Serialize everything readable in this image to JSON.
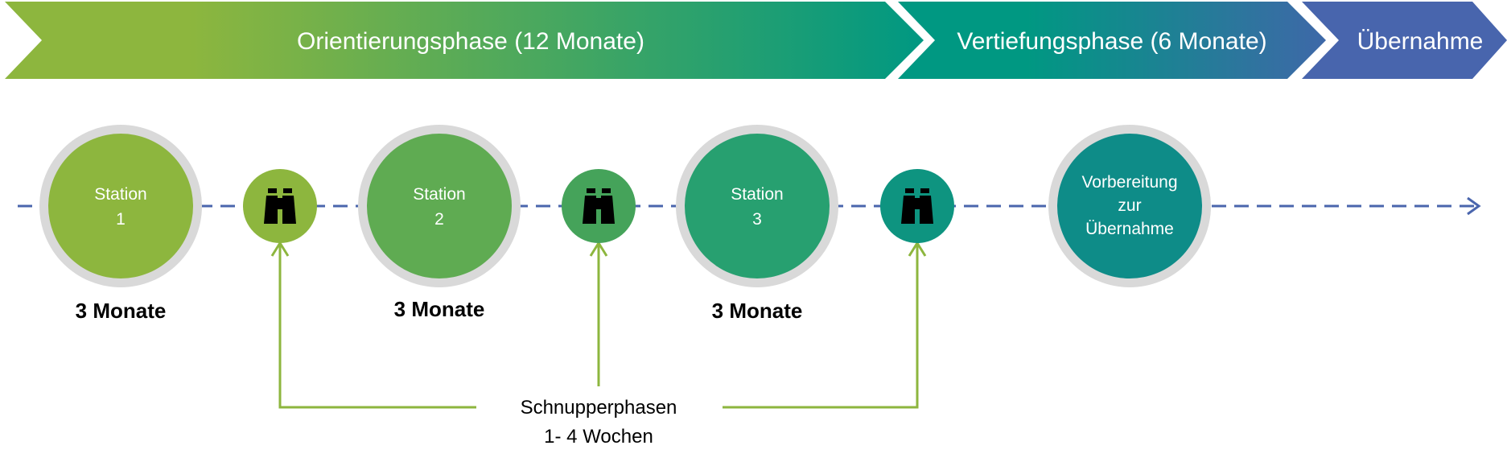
{
  "phases": [
    {
      "label": "Orientierungsphase (12 Monate)"
    },
    {
      "label": "Vertiefungsphase (6 Monate)"
    },
    {
      "label": "Übernahme"
    }
  ],
  "stations": [
    {
      "line1": "Station",
      "line2": "1",
      "duration": "3 Monate",
      "color": "#8db63e"
    },
    {
      "line1": "Station",
      "line2": "2",
      "duration": "3 Monate",
      "color": "#5fab52"
    },
    {
      "line1": "Station",
      "line2": "3",
      "duration": "3 Monate",
      "color": "#27a070"
    }
  ],
  "final_station": {
    "line1": "Vorbereitung",
    "line2": "zur",
    "line3": "Übernahme",
    "color": "#0e8c88"
  },
  "trial_phases": {
    "icon": "binoculars-icon",
    "colors": [
      "#8db63e",
      "#45a35a",
      "#0e9480"
    ],
    "label_line1": "Schnupperphasen",
    "label_line2": "1- 4 Wochen"
  },
  "colors": {
    "ring": "#d9d9d9",
    "timeline": "#4a65ad",
    "connector": "#8db63e"
  }
}
